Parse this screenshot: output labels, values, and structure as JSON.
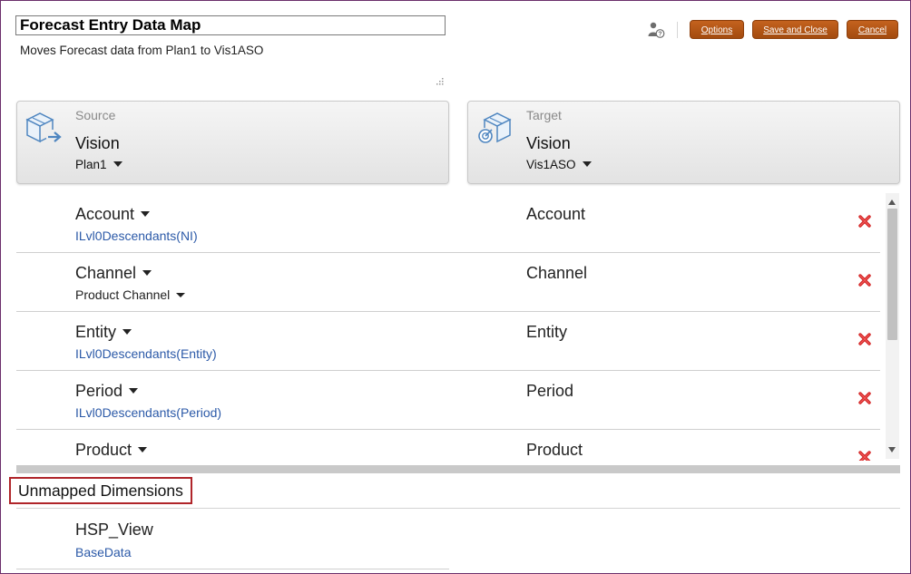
{
  "header": {
    "title": "Forecast Entry Data Map",
    "subtitle": "Moves Forecast data from Plan1 to Vis1ASO"
  },
  "toolbar": {
    "options_label": "Options",
    "save_close_label": "Save and Close",
    "cancel_label": "Cancel"
  },
  "source": {
    "label": "Source",
    "app": "Vision",
    "cube": "Plan1"
  },
  "target": {
    "label": "Target",
    "app": "Vision",
    "cube": "Vis1ASO"
  },
  "mappings": [
    {
      "source_dim": "Account",
      "source_member": "ILvl0Descendants(NI)",
      "target_dim": "Account"
    },
    {
      "source_dim": "Channel",
      "source_member": "Product Channel",
      "target_dim": "Channel"
    },
    {
      "source_dim": "Entity",
      "source_member": "ILvl0Descendants(Entity)",
      "target_dim": "Entity"
    },
    {
      "source_dim": "Period",
      "source_member": "ILvl0Descendants(Period)",
      "target_dim": "Period"
    },
    {
      "source_dim": "Product",
      "source_member": "",
      "target_dim": "Product"
    }
  ],
  "unmapped": {
    "heading": "Unmapped Dimensions",
    "items": [
      {
        "dim": "HSP_View",
        "member": "BaseData"
      }
    ]
  },
  "colors": {
    "button": "#b1540f",
    "link": "#2c5aa8",
    "delete": "#d22222",
    "highlight_border": "#b0252a"
  }
}
